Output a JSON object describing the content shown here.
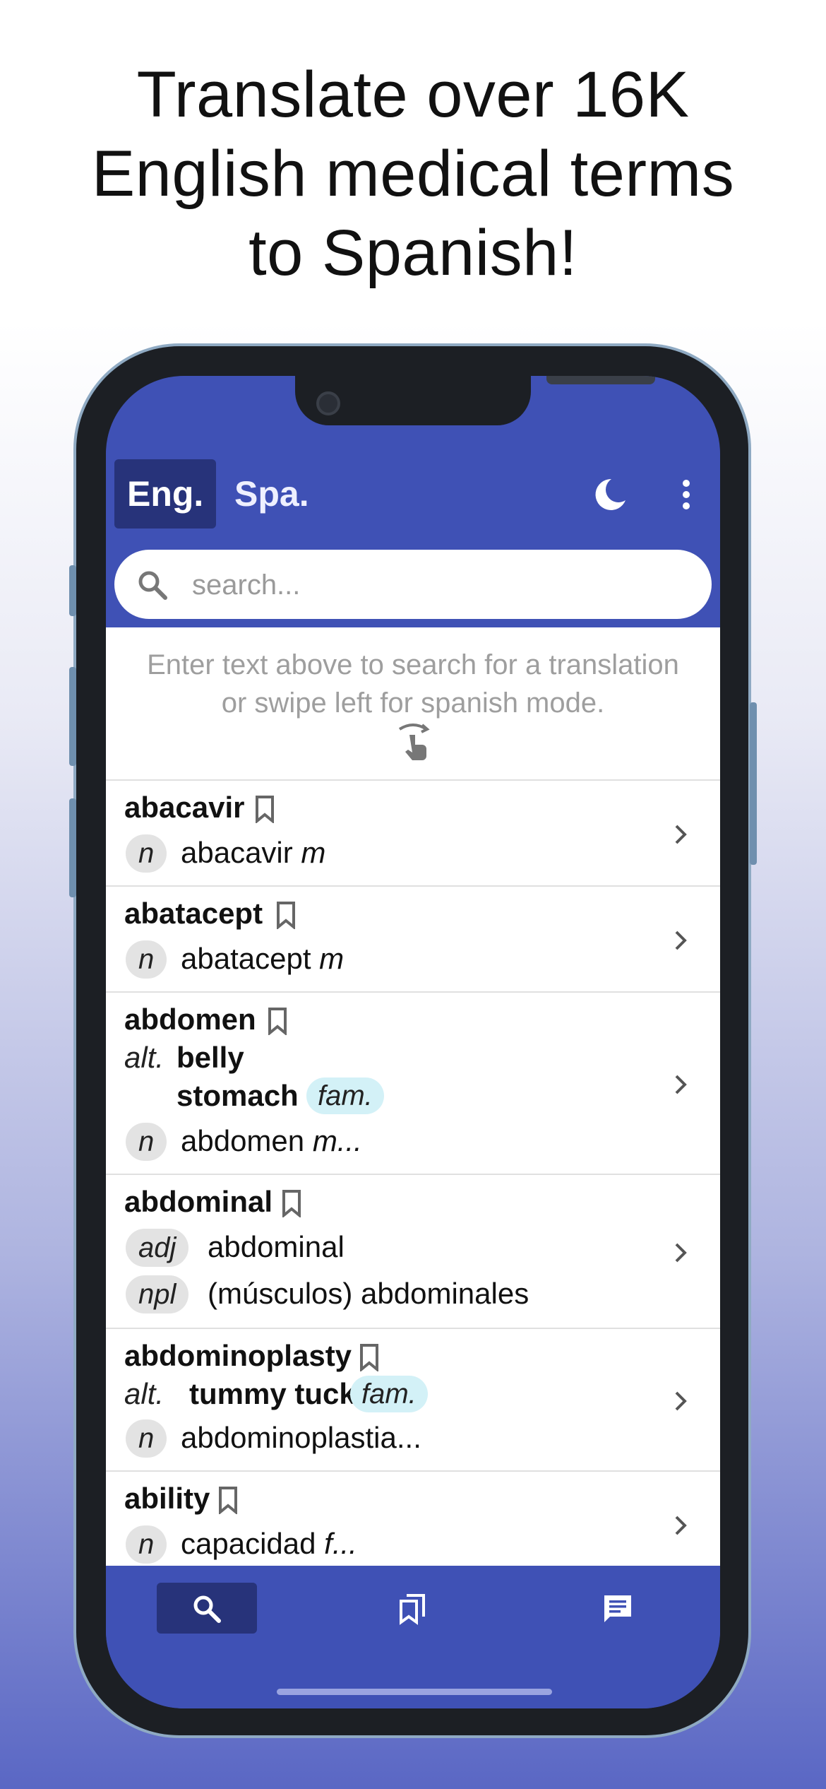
{
  "headline": {
    "line1": "Translate over 16K",
    "line2": "English medical terms",
    "line3": "to Spanish!"
  },
  "appbar": {
    "tab_english": "Eng.",
    "tab_spanish": "Spa.",
    "theme_icon": "moon-icon",
    "menu_icon": "more-vert-icon"
  },
  "search": {
    "placeholder": "search...",
    "value": ""
  },
  "hint": {
    "line1": "Enter text above to search for a translation",
    "line2": "or swipe left for spanish mode."
  },
  "entries": [
    {
      "term": "abacavir",
      "pos1": "n",
      "trans1": "abacavir ",
      "gender1": "m"
    },
    {
      "term": "abatacept",
      "pos1": "n",
      "trans1": "abatacept ",
      "gender1": "m"
    },
    {
      "term": "abdomen",
      "alt_label": "alt.",
      "alt1": "belly",
      "alt2": "stomach",
      "tag": "fam.",
      "pos1": "n",
      "trans1": "abdomen ",
      "gender1": "m..."
    },
    {
      "term": "abdominal",
      "pos1": "adj",
      "trans1": "abdominal",
      "pos2": "npl",
      "trans2": "(músculos) abdominales"
    },
    {
      "term": "abdominoplasty",
      "alt_label": "alt.",
      "alt1": "tummy tuck",
      "tag": "fam.",
      "pos1": "n",
      "trans1": "abdominoplastia..."
    },
    {
      "term": "ability",
      "pos1": "n",
      "trans1": "capacidad ",
      "gender1": "f..."
    }
  ],
  "bottom_nav": {
    "search_icon": "search-icon",
    "bookmarks_icon": "bookmarks-icon",
    "feedback_icon": "feedback-icon"
  },
  "colors": {
    "primary": "#3f51b5",
    "primary_dark": "#27337a",
    "fam_tag": "#d3f1f7",
    "pos_chip": "#e3e3e3"
  }
}
